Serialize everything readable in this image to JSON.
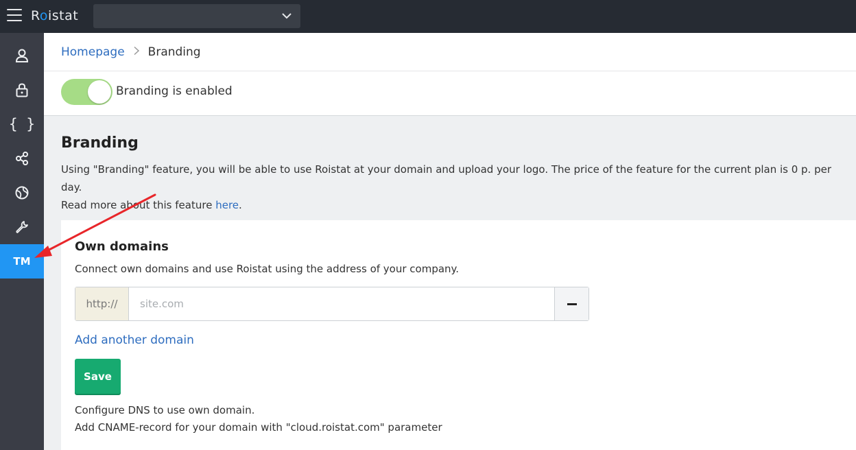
{
  "header": {
    "logo": {
      "before": "R",
      "dot": "o",
      "after": "istat"
    },
    "project_select_value": ""
  },
  "sidebar": {
    "items": [
      {
        "icon": "user-icon"
      },
      {
        "icon": "lock-icon"
      },
      {
        "icon": "braces-icon",
        "glyph": "{ }"
      },
      {
        "icon": "share-icon"
      },
      {
        "icon": "globe-icon"
      },
      {
        "icon": "wrench-icon"
      },
      {
        "icon": "trademark-icon",
        "label": "TM",
        "active": true
      }
    ]
  },
  "breadcrumb": {
    "home": "Homepage",
    "current": "Branding"
  },
  "toggle": {
    "label": "Branding is enabled",
    "enabled": true
  },
  "main": {
    "title": "Branding",
    "description": "Using \"Branding\" feature, you will be able to use Roistat at your domain and upload your logo. The price of the feature for the current plan is 0 p. per day.",
    "read_more": "Read more about this feature",
    "link_text": "here",
    "period": "."
  },
  "own_domains": {
    "title": "Own domains",
    "subtitle": "Connect own domains and use Roistat using the address of your company.",
    "prefix": "http://",
    "placeholder": "site.com",
    "value": "",
    "add_link": "Add another domain",
    "save_label": "Save",
    "dns_line1": "Configure DNS to use own domain.",
    "dns_line2": "Add CNAME-record for your domain with \"cloud.roistat.com\" parameter"
  },
  "colors": {
    "topbar": "#262b33",
    "sidebar": "#3a3d46",
    "accent": "#2196f3",
    "toggle_on": "#a6dc86",
    "save": "#17aa70",
    "link": "#2e6dbf",
    "annotation_arrow": "#e8262a"
  }
}
